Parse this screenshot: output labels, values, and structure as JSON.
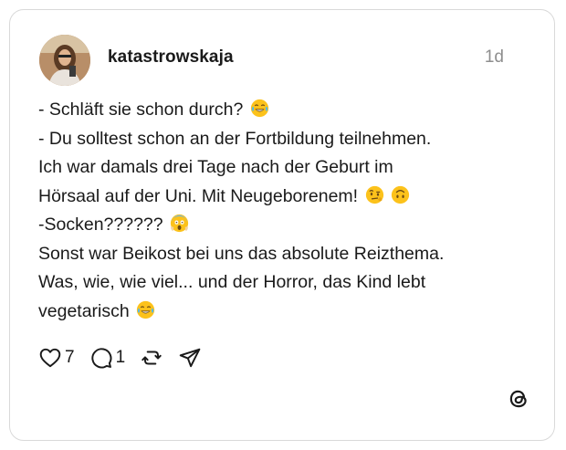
{
  "post": {
    "username": "katastrowskaja",
    "timestamp": "1d",
    "lines": [
      "- Schläft sie schon durch?",
      "- Du solltest schon an der Fortbildung teilnehmen.",
      "Ich war damals drei Tage nach der Geburt im",
      "Hörsaal auf der Uni. Mit Neugeborenem!",
      "-Socken??????",
      "Sonst war Beikost bei uns das absolute Reizthema.",
      "Was, wie, wie viel... und der Horror, das Kind lebt",
      "vegetarisch"
    ],
    "emojis": {
      "line1": "face-with-tears-of-joy",
      "line4a": "face-with-raised-eyebrow",
      "line4b": "upside-down-face",
      "line5": "face-screaming-in-fear",
      "line8": "face-with-tears-of-joy"
    }
  },
  "actions": {
    "like_count": "7",
    "reply_count": "1"
  },
  "icons": {
    "like": "heart-icon",
    "reply": "comment-icon",
    "repost": "repost-icon",
    "share": "send-icon",
    "brand": "threads-logo-icon"
  },
  "colors": {
    "text": "#1a1a1a",
    "muted": "#8e8e8e",
    "border": "#d9d9d9",
    "emoji_yellow": "#fcc21b"
  }
}
